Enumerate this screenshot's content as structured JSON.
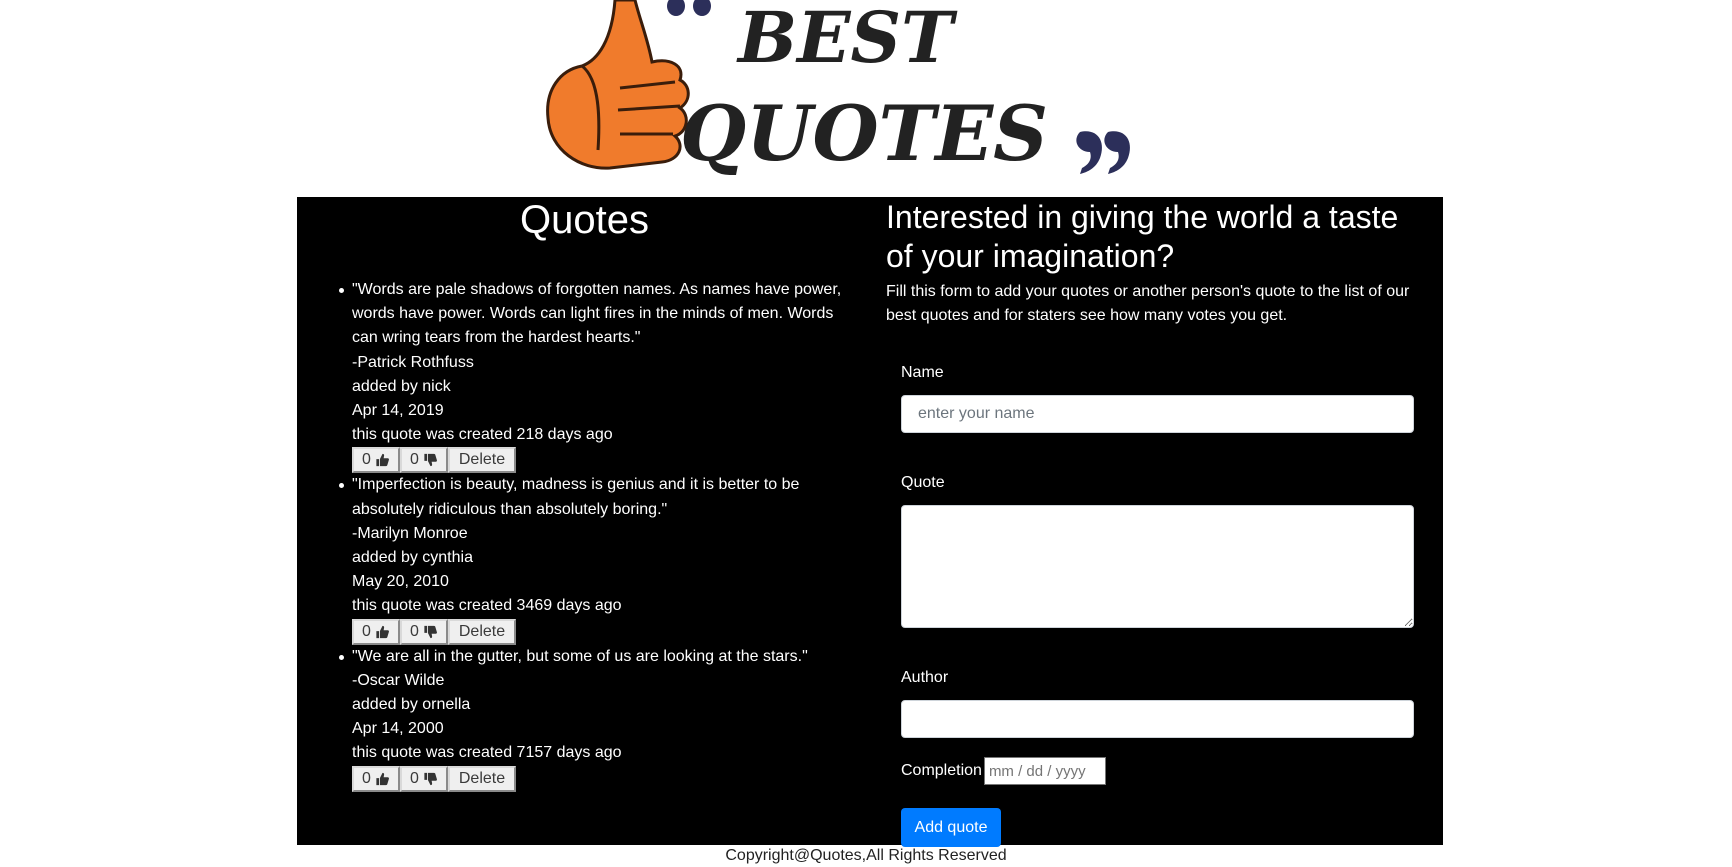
{
  "logo": {
    "line1": "BEST",
    "line2": "QUOTES",
    "open_quote": "“",
    "close_quote": "”"
  },
  "quotes_section": {
    "title": "Quotes",
    "items": [
      {
        "text_lines": [
          "\"Words are pale shadows of forgotten names. As names have power,",
          "words have power. Words can light fires in the minds of men. Words",
          "can wring tears from the hardest hearts.\""
        ],
        "author": "-Patrick Rothfuss",
        "added_by": "added by nick",
        "date": "Apr 14, 2019",
        "created": "this quote was created 218 days ago",
        "upvotes": "0",
        "downvotes": "0",
        "delete_label": "Delete"
      },
      {
        "text_lines": [
          "\"Imperfection is beauty, madness is genius and it is better to be",
          "absolutely ridiculous than absolutely boring.\""
        ],
        "author": "-Marilyn Monroe",
        "added_by": "added by cynthia",
        "date": "May 20, 2010",
        "created": "this quote was created 3469 days ago",
        "upvotes": "0",
        "downvotes": "0",
        "delete_label": "Delete"
      },
      {
        "text_lines": [
          "\"We are all in the gutter, but some of us are looking at the stars.\""
        ],
        "author": "-Oscar Wilde",
        "added_by": "added by ornella",
        "date": "Apr 14, 2000",
        "created": "this quote was created 7157 days ago",
        "upvotes": "0",
        "downvotes": "0",
        "delete_label": "Delete"
      }
    ]
  },
  "form": {
    "heading": "Interested in giving the world a taste of your imagination?",
    "description": "Fill this form to add your quotes or another person's quote to the list of our best quotes and for staters see how many votes you get.",
    "name_label": "Name",
    "name_placeholder": "enter your name",
    "name_value": "",
    "quote_label": "Quote",
    "quote_value": "",
    "author_label": "Author",
    "author_value": "",
    "completion_label": "Completion",
    "date_placeholder": "mm / dd / yyyy",
    "submit_label": "Add quote"
  },
  "footer": {
    "text": "Copyright@Quotes,All Rights Reserved"
  },
  "colors": {
    "panel_bg": "#000000",
    "accent": "#007bff",
    "logo_orange": "#f07b2c",
    "logo_text": "#222222",
    "logo_quote": "#2c2f5a"
  }
}
